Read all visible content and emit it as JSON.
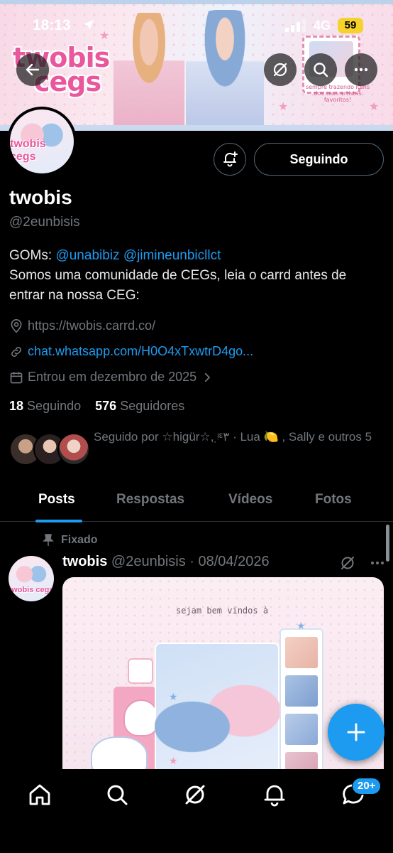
{
  "status_bar": {
    "time": "18:13",
    "network": "4G",
    "battery": "59"
  },
  "banner": {
    "logo_line1": "twobis",
    "logo_line2": "cegs",
    "tagline": "sempre trazendo itens dos seus artistas favoritos!"
  },
  "profile": {
    "avatar_text": "twobis cegs",
    "follow_button": "Seguindo",
    "display_name": "twobis",
    "handle": "@2eunbisis",
    "bio_prefix": "GOMs: ",
    "bio_mention1": "@unabibiz",
    "bio_mention2": "@jimineunbicllct",
    "bio_rest": " Somos uma comunidade de CEGs, leia o carrd antes de entrar na nossa CEG:",
    "location_url": "https://twobis.carrd.co/",
    "link": "chat.whatsapp.com/H0O4xTxwtrD4go...",
    "joined": "Entrou em dezembro de 2025",
    "following_count": "18",
    "following_label": "Seguindo",
    "followers_count": "576",
    "followers_label": "Seguidores",
    "followed_by": "Seguido por ☆higür☆, ᵎ̣ᵋ۳ · Lua 🍋 , Sally e outros 5"
  },
  "tabs": [
    {
      "label": "Posts",
      "active": true
    },
    {
      "label": "Respostas",
      "active": false
    },
    {
      "label": "Vídeos",
      "active": false
    },
    {
      "label": "Fotos",
      "active": false
    }
  ],
  "pinned_post": {
    "pinned_label": "Fixado",
    "author": "twobis",
    "handle_date": "@2eunbisis · 08/04/2026",
    "media_text": "sejam bem vindos à"
  },
  "bottom_nav": {
    "items": [
      "home-icon",
      "search-icon",
      "grok-icon",
      "notifications-icon",
      "messages-icon"
    ],
    "messages_badge": "20+"
  },
  "colors": {
    "accent": "#1d9bf0",
    "background": "#000000",
    "muted": "#71767b"
  }
}
